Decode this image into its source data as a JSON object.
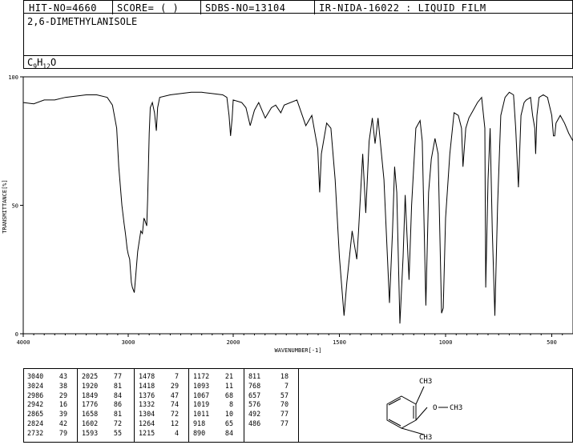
{
  "header": {
    "hit_no": "HIT-NO=4660",
    "score": "SCORE=  (   )",
    "sdbs_no": "SDBS-NO=13104",
    "ir_info": "IR-NIDA-16022 : LIQUID FILM"
  },
  "compound": {
    "name": "2,6-DIMETHYLANISOLE",
    "formula_parts": [
      "C",
      "9",
      "H",
      "12",
      "O"
    ]
  },
  "chart_data": {
    "type": "line",
    "xlabel": "WAVENUMBER[-1]",
    "ylabel": "TRANSMITTANCE[%]",
    "xlim": [
      4000,
      400
    ],
    "ylim": [
      0,
      100
    ],
    "x_ticks": [
      "4000",
      "3000",
      "2000",
      "1500",
      "1000",
      "500"
    ],
    "x_tick_values": [
      4000,
      3000,
      2000,
      1500,
      1000,
      500
    ],
    "y_ticks": [
      "0",
      "50",
      "100"
    ],
    "y_tick_values": [
      0,
      50,
      100
    ],
    "series": [
      {
        "points": [
          [
            4000,
            90
          ],
          [
            3900,
            89.5
          ],
          [
            3800,
            91
          ],
          [
            3700,
            91
          ],
          [
            3600,
            92
          ],
          [
            3500,
            92.5
          ],
          [
            3400,
            93
          ],
          [
            3300,
            93
          ],
          [
            3200,
            92
          ],
          [
            3150,
            89
          ],
          [
            3110,
            80
          ],
          [
            3090,
            65
          ],
          [
            3060,
            50
          ],
          [
            3040,
            43
          ],
          [
            3030,
            40
          ],
          [
            3024,
            38
          ],
          [
            3010,
            33
          ],
          [
            3000,
            31
          ],
          [
            2986,
            29
          ],
          [
            2970,
            20
          ],
          [
            2960,
            18
          ],
          [
            2942,
            16
          ],
          [
            2930,
            22
          ],
          [
            2910,
            32
          ],
          [
            2880,
            40
          ],
          [
            2865,
            39
          ],
          [
            2850,
            45
          ],
          [
            2840,
            44
          ],
          [
            2824,
            42
          ],
          [
            2815,
            52
          ],
          [
            2800,
            78
          ],
          [
            2790,
            88
          ],
          [
            2770,
            90
          ],
          [
            2750,
            86
          ],
          [
            2732,
            79
          ],
          [
            2720,
            88
          ],
          [
            2700,
            92
          ],
          [
            2600,
            93
          ],
          [
            2500,
            93.5
          ],
          [
            2400,
            94
          ],
          [
            2300,
            94
          ],
          [
            2200,
            93.5
          ],
          [
            2100,
            93
          ],
          [
            2060,
            92
          ],
          [
            2040,
            85
          ],
          [
            2025,
            77
          ],
          [
            2010,
            84
          ],
          [
            2000,
            91
          ],
          [
            1960,
            90
          ],
          [
            1940,
            88
          ],
          [
            1920,
            81
          ],
          [
            1900,
            87
          ],
          [
            1880,
            90
          ],
          [
            1849,
            84
          ],
          [
            1820,
            88
          ],
          [
            1800,
            89
          ],
          [
            1776,
            86
          ],
          [
            1760,
            89
          ],
          [
            1700,
            91
          ],
          [
            1658,
            81
          ],
          [
            1630,
            85
          ],
          [
            1602,
            72
          ],
          [
            1593,
            55
          ],
          [
            1585,
            70
          ],
          [
            1560,
            82
          ],
          [
            1540,
            80
          ],
          [
            1520,
            60
          ],
          [
            1500,
            30
          ],
          [
            1478,
            7
          ],
          [
            1465,
            20
          ],
          [
            1440,
            40
          ],
          [
            1418,
            29
          ],
          [
            1410,
            40
          ],
          [
            1390,
            70
          ],
          [
            1376,
            47
          ],
          [
            1360,
            75
          ],
          [
            1345,
            84
          ],
          [
            1332,
            74
          ],
          [
            1318,
            84
          ],
          [
            1304,
            72
          ],
          [
            1290,
            60
          ],
          [
            1264,
            12
          ],
          [
            1250,
            40
          ],
          [
            1240,
            65
          ],
          [
            1230,
            55
          ],
          [
            1215,
            4
          ],
          [
            1200,
            30
          ],
          [
            1190,
            54
          ],
          [
            1172,
            21
          ],
          [
            1160,
            50
          ],
          [
            1140,
            80
          ],
          [
            1120,
            83
          ],
          [
            1110,
            75
          ],
          [
            1093,
            11
          ],
          [
            1080,
            55
          ],
          [
            1067,
            68
          ],
          [
            1050,
            76
          ],
          [
            1035,
            70
          ],
          [
            1019,
            8
          ],
          [
            1011,
            10
          ],
          [
            1000,
            45
          ],
          [
            980,
            70
          ],
          [
            960,
            86
          ],
          [
            940,
            85
          ],
          [
            925,
            80
          ],
          [
            918,
            65
          ],
          [
            905,
            80
          ],
          [
            890,
            84
          ],
          [
            870,
            87
          ],
          [
            850,
            90
          ],
          [
            830,
            92
          ],
          [
            815,
            80
          ],
          [
            811,
            18
          ],
          [
            800,
            60
          ],
          [
            790,
            80
          ],
          [
            780,
            40
          ],
          [
            768,
            7
          ],
          [
            755,
            50
          ],
          [
            740,
            85
          ],
          [
            720,
            92
          ],
          [
            700,
            94
          ],
          [
            680,
            93
          ],
          [
            670,
            80
          ],
          [
            657,
            57
          ],
          [
            645,
            85
          ],
          [
            630,
            90
          ],
          [
            620,
            91
          ],
          [
            600,
            92
          ],
          [
            590,
            85
          ],
          [
            580,
            80
          ],
          [
            576,
            70
          ],
          [
            570,
            85
          ],
          [
            560,
            92
          ],
          [
            540,
            93
          ],
          [
            520,
            92
          ],
          [
            500,
            85
          ],
          [
            492,
            77
          ],
          [
            486,
            77
          ],
          [
            480,
            82
          ],
          [
            460,
            85
          ],
          [
            440,
            82
          ],
          [
            420,
            78
          ],
          [
            400,
            75
          ]
        ]
      }
    ]
  },
  "peak_table": [
    [
      [
        "3040",
        "43"
      ],
      [
        "3024",
        "38"
      ],
      [
        "2986",
        "29"
      ],
      [
        "2942",
        "16"
      ],
      [
        "2865",
        "39"
      ],
      [
        "2824",
        "42"
      ],
      [
        "2732",
        "79"
      ]
    ],
    [
      [
        "2025",
        "77"
      ],
      [
        "1920",
        "81"
      ],
      [
        "1849",
        "84"
      ],
      [
        "1776",
        "86"
      ],
      [
        "1658",
        "81"
      ],
      [
        "1602",
        "72"
      ],
      [
        "1593",
        "55"
      ]
    ],
    [
      [
        "1478",
        "7"
      ],
      [
        "1418",
        "29"
      ],
      [
        "1376",
        "47"
      ],
      [
        "1332",
        "74"
      ],
      [
        "1304",
        "72"
      ],
      [
        "1264",
        "12"
      ],
      [
        "1215",
        "4"
      ]
    ],
    [
      [
        "1172",
        "21"
      ],
      [
        "1093",
        "11"
      ],
      [
        "1067",
        "68"
      ],
      [
        "1019",
        "8"
      ],
      [
        "1011",
        "10"
      ],
      [
        "918",
        "65"
      ],
      [
        "890",
        "84"
      ]
    ],
    [
      [
        "811",
        "18"
      ],
      [
        "768",
        "7"
      ],
      [
        "657",
        "57"
      ],
      [
        "576",
        "70"
      ],
      [
        "492",
        "77"
      ],
      [
        "486",
        "77"
      ]
    ]
  ],
  "structure": {
    "labels": [
      "CH3",
      "O",
      "CH3",
      "CH3"
    ]
  }
}
